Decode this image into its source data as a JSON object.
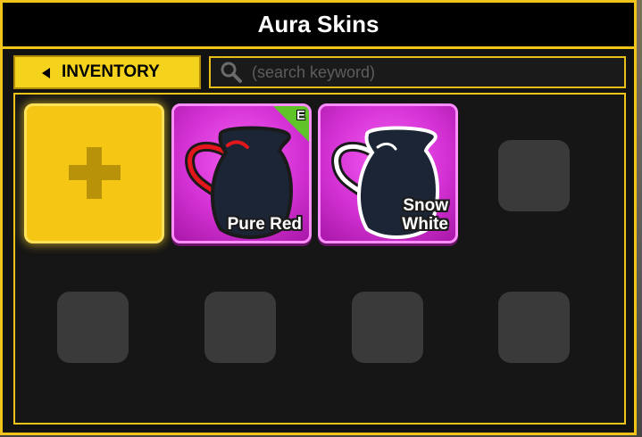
{
  "window": {
    "title": "Aura Skins"
  },
  "toolbar": {
    "inventory_label": "INVENTORY",
    "search_placeholder": "(search keyword)"
  },
  "grid": {
    "add_slot": {
      "icon": "plus-icon"
    },
    "skins": [
      {
        "name": "Pure Red",
        "equipped": true,
        "badge": "E",
        "outline_color": "#e3161c"
      },
      {
        "name": "Snow\nWhite",
        "equipped": false,
        "badge": "",
        "outline_color": "#ffffff"
      }
    ],
    "empty_slot_count": 5
  },
  "colors": {
    "accent": "#f2c318",
    "card_magenta": "#d432d4",
    "equip_badge": "#5fc428"
  }
}
